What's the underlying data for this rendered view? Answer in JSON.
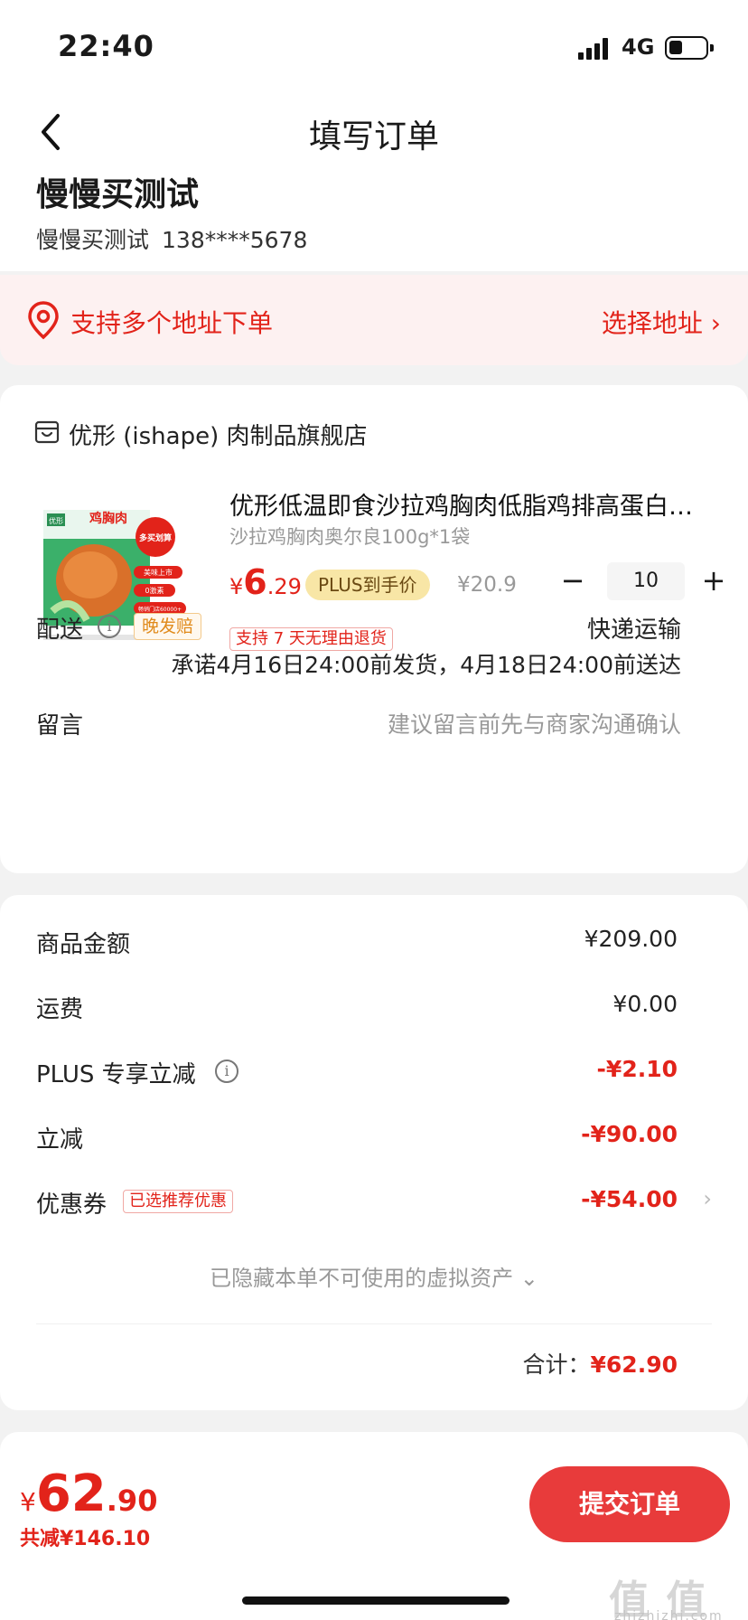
{
  "status_bar": {
    "time": "22:40",
    "network": "4G"
  },
  "nav": {
    "title": "填写订单"
  },
  "receiver": {
    "name": "慢慢买测试",
    "contact_name": "慢慢买测试",
    "phone": "138****5678"
  },
  "address_banner": {
    "tip": "支持多个地址下单",
    "action": "选择地址 ›"
  },
  "store": {
    "name": "优形 (ishape) 肉制品旗舰店",
    "product": {
      "title": "优形低温即食沙拉鸡胸肉低脂鸡排高蛋白…",
      "spec": "沙拉鸡胸肉奥尔良100g*1袋",
      "price_symbol": "¥",
      "price_int": "6",
      "price_dec": ".29",
      "plus_tag": "PLUS到手价",
      "orig_price": "¥20.9",
      "quantity": "10",
      "minus": "−",
      "plus": "+",
      "return_tag": "支持 7 天无理由退货",
      "image_texts": {
        "brand": "优形",
        "name": "鸡胸肉",
        "badge": "多买划算",
        "tag1": "美味上市",
        "tag2": "0激素",
        "tag3": "畅销门店60000+"
      }
    },
    "delivery": {
      "label": "配送",
      "late_tag": "晚发赔",
      "method": "快递运输",
      "promise": "承诺4月16日24:00前发货，4月18日24:00前送达"
    },
    "remark": {
      "label": "留言",
      "placeholder": "建议留言前先与商家沟通确认"
    }
  },
  "fees": {
    "goods_label": "商品金额",
    "goods_value": "¥209.00",
    "shipping_label": "运费",
    "shipping_value": "¥0.00",
    "plus_label": "PLUS 专享立减",
    "plus_value": "-¥2.10",
    "discount_label": "立减",
    "discount_value": "-¥90.00",
    "coupon_label": "优惠券",
    "coupon_tag": "已选推荐优惠",
    "coupon_value": "-¥54.00",
    "hidden_assets": "已隐藏本单不可使用的虚拟资产 ⌄",
    "total_label": "合计：",
    "total_value": "¥62.90"
  },
  "bottom": {
    "symbol": "¥",
    "int": "62",
    "dec": ".90",
    "saved": "共减¥146.10",
    "submit": "提交订单",
    "watermark": "值 值 值",
    "watermark_sub": "zhizhizhi.com"
  },
  "colors": {
    "accent": "#e2231a",
    "button": "#e83b3b",
    "plus_tag_bg": "#f8e6a6",
    "banner_bg": "#fdf1f1"
  },
  "icons": [
    "back-arrow-icon",
    "location-pin-icon",
    "store-icon",
    "info-icon",
    "chevron-right-icon",
    "chevron-down-icon",
    "signal-icon",
    "battery-icon"
  ]
}
